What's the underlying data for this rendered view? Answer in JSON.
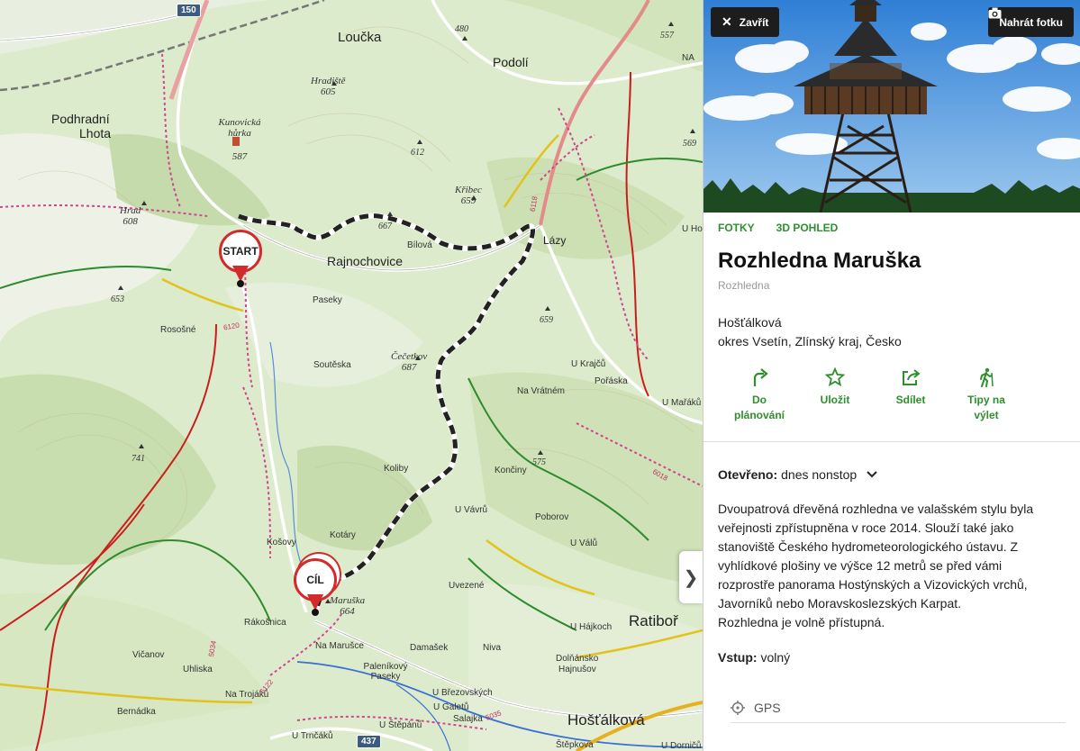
{
  "map": {
    "places": [
      {
        "name": "Loučka"
      },
      {
        "name": "Podolí"
      },
      {
        "name": "Podhradní"
      },
      {
        "name": "Lhota"
      },
      {
        "name": "Rajnochovice"
      },
      {
        "name": "Lázy"
      },
      {
        "name": "Ratiboř"
      },
      {
        "name": "Hošťálková"
      }
    ],
    "small_places": [
      "Bílová",
      "Paseky",
      "Rosošné",
      "Soutěska",
      "Na Vrátném",
      "U Krajčů",
      "Pořáska",
      "U Mařáků",
      "Končiny",
      "Koliby",
      "U Vávrů",
      "Poborov",
      "U Válů",
      "Kotáry",
      "Košovy",
      "Uvezené",
      "Rákošnica",
      "U Hájkoch",
      "Na Marušce",
      "Damašek",
      "Niva",
      "Dolňánsko",
      "Hajnušov",
      "Vičanov",
      "Uhliska",
      "Paleníkový Paseky",
      "Na Trojáků",
      "Bernádka",
      "U Březovských",
      "U Galetů",
      "Salajka",
      "U Štěpánů",
      "U Trnčáků",
      "Štěpkova",
      "U Dorničů",
      "U Horn",
      "NA"
    ],
    "peaks": [
      {
        "name": "Hradiště",
        "elev": "605"
      },
      {
        "name": "Kunovická hůrka",
        "elev": "587"
      },
      {
        "name": "Křibec",
        "elev": "659"
      },
      {
        "name": "Hrad",
        "elev": "608"
      },
      {
        "name": "Čečetkov",
        "elev": "687"
      },
      {
        "name": "Maruška",
        "elev": "664"
      }
    ],
    "elevations": [
      "480",
      "557",
      "612",
      "667",
      "569",
      "653",
      "659",
      "741",
      "575"
    ],
    "road_shields": [
      "150",
      "437"
    ],
    "route_numbers": [
      "6118",
      "6120",
      "5034",
      "6122",
      "5035",
      "6018"
    ],
    "start_label": "START",
    "end_label": "CÍL",
    "collapse_icon": "chevron-right"
  },
  "panel": {
    "close_label": "Zavřít",
    "upload_label": "Nahrát fotku",
    "tabs": [
      "FOTKY",
      "3D POHLED"
    ],
    "title": "Rozhledna Maruška",
    "type": "Rozhledna",
    "address_line1": "Hošťálková",
    "address_line2": "okres Vsetín, Zlínský kraj, Česko",
    "actions": [
      {
        "icon": "route-arrow-icon",
        "line1": "Do",
        "line2": "plánování"
      },
      {
        "icon": "star-icon",
        "line1": "Uložit",
        "line2": ""
      },
      {
        "icon": "share-icon",
        "line1": "Sdílet",
        "line2": ""
      },
      {
        "icon": "hiker-icon",
        "line1": "Tipy na",
        "line2": "výlet"
      }
    ],
    "hours_label": "Otevřeno:",
    "hours_value": "dnes nonstop",
    "description_lines": [
      "Dvoupatrová dřevěná rozhledna ve valašském stylu byla",
      "veřejnosti zpřístupněna v roce 2014. Slouží také jako",
      "stanoviště Českého hydrometeorologického ústavu. Z",
      "vyhlídkové plošiny ve výšce 12 metrů se před vámi",
      "rozprostře panorama Hostýnských a Vizovických vrchů,",
      "Javorníků nebo Moravskoslezských Karpat.",
      "Rozhledna je volně přístupná."
    ],
    "entry_label": "Vstup:",
    "entry_value": "volný",
    "gps_label": "GPS"
  },
  "colors": {
    "accent_green": "#2f8f2f",
    "marker_red": "#d12b2b"
  }
}
